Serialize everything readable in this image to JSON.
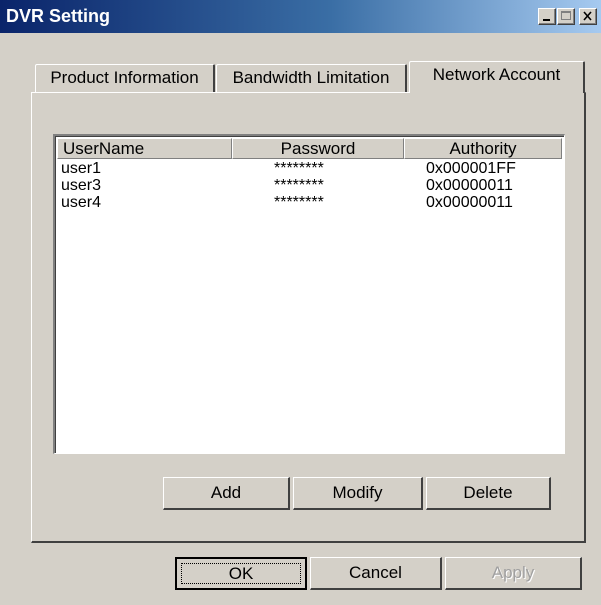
{
  "window": {
    "title": "DVR Setting",
    "caption_buttons": [
      "minimize-icon",
      "maximize-icon",
      "close-icon"
    ],
    "colors": {
      "face": "#d4d0c8",
      "title_start": "#0a246a",
      "title_end": "#a6caf0"
    }
  },
  "tabs": [
    {
      "label": "Product Information",
      "active": false
    },
    {
      "label": "Bandwidth Limitation",
      "active": false
    },
    {
      "label": "Network Account",
      "active": true
    }
  ],
  "accounts": {
    "columns": [
      "UserName",
      "Password",
      "Authority"
    ],
    "rows": [
      {
        "username": "user1",
        "password": "********",
        "authority": "0x000001FF"
      },
      {
        "username": "user3",
        "password": "********",
        "authority": "0x00000011"
      },
      {
        "username": "user4",
        "password": "********",
        "authority": "0x00000011"
      }
    ]
  },
  "panel_buttons": {
    "add": "Add",
    "modify": "Modify",
    "delete": "Delete"
  },
  "dialog_buttons": {
    "ok": "OK",
    "cancel": "Cancel",
    "apply": "Apply"
  }
}
